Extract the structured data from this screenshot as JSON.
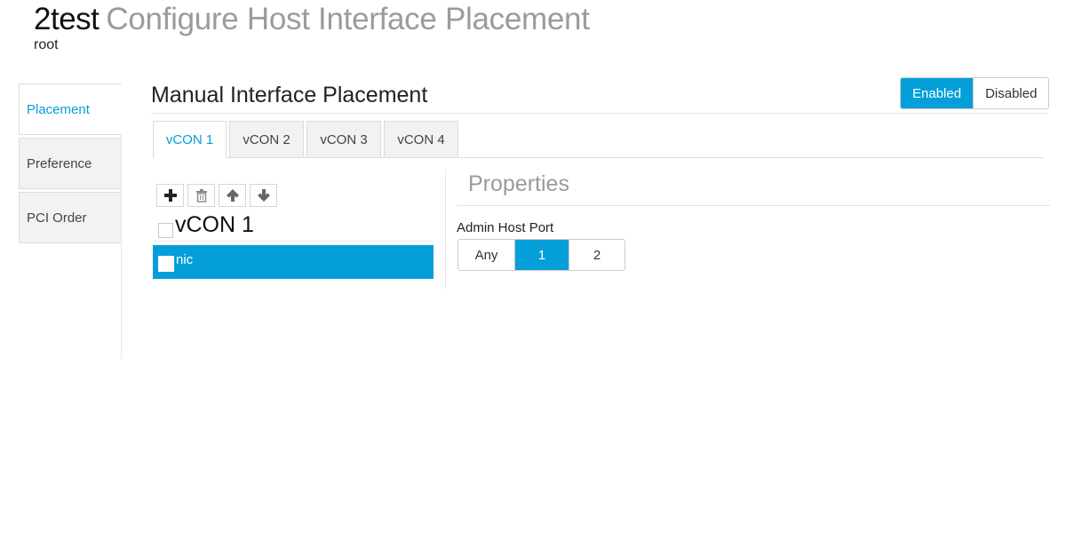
{
  "header": {
    "name": "2test",
    "title": "Configure Host Interface Placement",
    "subtitle": "root"
  },
  "side_tabs": [
    {
      "label": "Placement",
      "active": true
    },
    {
      "label": "Preference",
      "active": false
    },
    {
      "label": "PCI Order",
      "active": false
    }
  ],
  "section": {
    "title": "Manual Interface Placement"
  },
  "toggle": {
    "options": [
      "Enabled",
      "Disabled"
    ],
    "selected": "Enabled"
  },
  "vcon_tabs": [
    {
      "label": "vCON 1",
      "active": true
    },
    {
      "label": "vCON 2",
      "active": false
    },
    {
      "label": "vCON 3",
      "active": false
    },
    {
      "label": "vCON 4",
      "active": false
    }
  ],
  "toolbar": {
    "buttons": [
      {
        "icon": "plus-icon",
        "action": "add"
      },
      {
        "icon": "trash-icon",
        "action": "delete"
      },
      {
        "icon": "arrow-up-icon",
        "action": "move-up"
      },
      {
        "icon": "arrow-down-icon",
        "action": "move-down"
      }
    ]
  },
  "tree": {
    "root_label": "vCON 1",
    "items": [
      {
        "label": "nic",
        "selected": true
      }
    ]
  },
  "properties": {
    "title": "Properties",
    "admin_host_port": {
      "label": "Admin Host Port",
      "options": [
        "Any",
        "1",
        "2"
      ],
      "selected": "1"
    }
  },
  "colors": {
    "accent": "#049fd9",
    "tab_inactive_bg": "#f2f2f2",
    "muted_text": "#9b9b9b"
  }
}
